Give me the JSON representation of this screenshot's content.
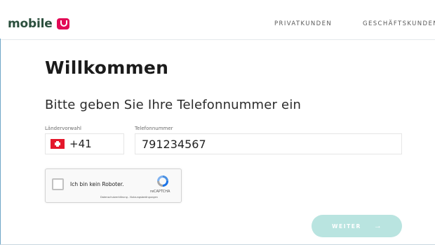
{
  "header": {
    "logo_text": "mobile",
    "nav": {
      "privatkunden": "PRIVATKUNDEN",
      "geschaeftskunden": "GESCHÄFTSKUNDEN"
    }
  },
  "main": {
    "title": "Willkommen",
    "subtitle": "Bitte geben Sie Ihre Telefonnummer ein",
    "country": {
      "label": "Ländervorwahl",
      "code": "+41",
      "flag_icon": "swiss-flag-icon"
    },
    "phone": {
      "label": "Telefonnummer",
      "value": "791234567"
    }
  },
  "recaptcha": {
    "label": "Ich bin kein Roboter.",
    "brand": "reCAPTCHA",
    "links": "Datenschutzerklärung - Nutzungsbedingungen"
  },
  "actions": {
    "submit_label": "WEITER",
    "submit_arrow": "→"
  },
  "colors": {
    "brand_text": "#2b4f3d",
    "brand_badge": "#e20a56",
    "submit_button": "#b9e4e0"
  }
}
